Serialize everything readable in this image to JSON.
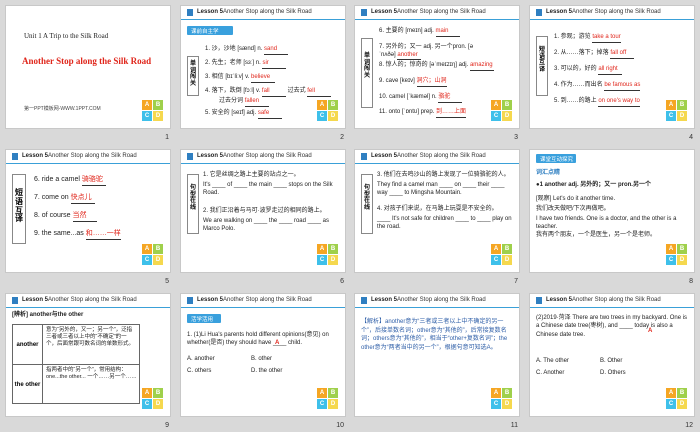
{
  "slides": [
    {
      "number": "1",
      "unit": "Unit 1  A Trip to the Silk Road",
      "title": "Another Stop along the Silk Road",
      "footer": "第一PPT模板网-WWW.1PPT.COM"
    },
    {
      "number": "2",
      "lesson": "Lesson 5",
      "topic": "Another Stop along the Silk Road",
      "banner": "课前自主学",
      "side_label": "单词闯关",
      "rows": [
        {
          "text": "1. 沙，沙地 [sænd] n.",
          "answer": "sand"
        },
        {
          "text": "2. 先生；老师 [sɜː] n.",
          "answer": "sir"
        },
        {
          "text": "3. 相信 [bɪˈliːv] v.",
          "answer": "believe"
        },
        {
          "text": "4. 落下，跌倒 [fɔːl] v.",
          "answer": "fall",
          "extra": "过去式",
          "extra_answer": "fell"
        },
        {
          "text": "过去分词",
          "answer": "fallen"
        },
        {
          "text": "5. 安全的 [seɪf] adj.",
          "answer": "safe"
        }
      ]
    },
    {
      "number": "3",
      "lesson": "Lesson 5",
      "topic": "Another Stop along the Silk Road",
      "side_label": "单词闯关",
      "rows": [
        {
          "text": "6. 主要的 [meɪn] adj.",
          "answer": "main"
        },
        {
          "text": "7. 另外的；又一 adj. 另一个pron. [əˈnʌðə]",
          "answer": "another"
        },
        {
          "text": "8. 惊人的；惊奇的 [əˈmeɪzɪŋ] adj.",
          "answer": "amazing"
        },
        {
          "text": "9. cave [keɪv]",
          "answer": "洞穴；山洞"
        },
        {
          "text": "10. camel [ˈkæməl] n.",
          "answer": "骆驼"
        },
        {
          "text": "11. onto [ˈɒntʊ] prep.",
          "answer": "到……上面"
        }
      ]
    },
    {
      "number": "4",
      "lesson": "Lesson 5",
      "topic": "Another Stop along the Silk Road",
      "side_label": "短语互译",
      "rows": [
        {
          "text": "1. 参观；游览",
          "answer": "take a tour"
        },
        {
          "text": "2. 从……落下；掉落",
          "answer": "fall off"
        },
        {
          "text": "3. 可以的，好的",
          "answer": "all right"
        },
        {
          "text": "4. 作为……而出名",
          "answer": "be famous as"
        },
        {
          "text": "5. 到……的路上",
          "answer": "on one's way to"
        }
      ]
    },
    {
      "number": "5",
      "lesson": "Lesson 5",
      "topic": "Another Stop along the Silk Road",
      "side_label": "短语互译",
      "rows": [
        {
          "text": "6. ride a camel",
          "answer": "骑骆驼"
        },
        {
          "text": "7. come on",
          "answer": "快点儿"
        },
        {
          "text": "8. of course",
          "answer": "当然"
        },
        {
          "text": "9. the same...as",
          "answer": "和……一样"
        }
      ]
    },
    {
      "number": "6",
      "lesson": "Lesson 5",
      "topic": "Another Stop along the Silk Road",
      "side_label": "句型在线",
      "lines": [
        "1. 它是丝绸之路上主要的站点之一。",
        "It's ____ of ____ the main ____ stops on the Silk Road.",
        "2. 我们正沿着与马可·波罗走过的相同的路上。",
        "We are walking on ____ the ____ road ____ as Marco Polo."
      ],
      "answers": [
        "one",
        "the",
        "stops",
        "the",
        "same",
        "as"
      ]
    },
    {
      "number": "7",
      "lesson": "Lesson 5",
      "topic": "Another Stop along the Silk Road",
      "side_label": "句型在线",
      "lines": [
        "3. 他们在去鸣沙山的路上发现了一位骑骆驼的人。",
        "They find a camel man ____ on ____ their ____ way ____ to Mingsha Mountain.",
        "4. 对孩子们来说，在马路上玩耍是不安全的。",
        "____ It's not safe for children ____ to ____ play on the road."
      ],
      "answers": [
        "on",
        "their",
        "way",
        "to",
        "It's",
        "to",
        "play"
      ]
    },
    {
      "number": "8",
      "lesson": "Lesson 5",
      "topic": "Another Stop along the Silk Road",
      "banner": "课堂互动探究",
      "subhead": "词汇点睛",
      "lines": [
        "●1  another adj. 另外的；又一 pron.另一个",
        "[观察] Let's do it another time.",
        "我们改天做吧/下次再做吧。",
        "I have two friends. One is a doctor, and the other is a teacher.",
        "我有两个朋友，一个是医生，另一个是老师。"
      ]
    },
    {
      "number": "9",
      "lesson": "Lesson 5",
      "topic": "Another Stop along the Silk Road",
      "subhead": "[辨析] another与the other",
      "table": [
        {
          "label": "another",
          "content": "意为“另外的，又一；另一个”，泛指三者或三者以上中的“不确定”的一个，后面常跟可数名词的单数形式。"
        },
        {
          "label": "the other",
          "content": "指两者中的“另一个”，常用结构：one...the other... 一个……另一个……"
        }
      ]
    },
    {
      "number": "10",
      "lesson": "Lesson 5",
      "topic": "Another Stop along the Silk Road",
      "banner": "活学活用",
      "question": "1. (1)Li Hua's parents hold different opinions(意见) on whether(是否) they should have ____ child.",
      "answer": "A",
      "options": [
        "A. another",
        "B. other",
        "C. others",
        "D. the other"
      ]
    },
    {
      "number": "11",
      "lesson": "Lesson 5",
      "topic": "Another Stop along the Silk Road",
      "analysis": "【解析】another意为“三者或三者以上中不确定的另一个”，后接单数名词；other意为“其他的”，后常接复数名词；others意为“其他的”，相当于“other+复数名词”；the other意为“两者当中的另一个”，根据句意可知选A。"
    },
    {
      "number": "12",
      "lesson": "Lesson 5",
      "topic": "Another Stop along the Silk Road",
      "question": "(2)2019·菏泽 There are two trees in my backyard. One is a Chinese date tree(枣树), and ____ today is also a Chinese date tree.",
      "answer": "A",
      "options": [
        "A. The other",
        "B. Other",
        "C. Another",
        "D. Others"
      ]
    }
  ],
  "block_letters": [
    "A",
    "B",
    "C",
    "D"
  ]
}
